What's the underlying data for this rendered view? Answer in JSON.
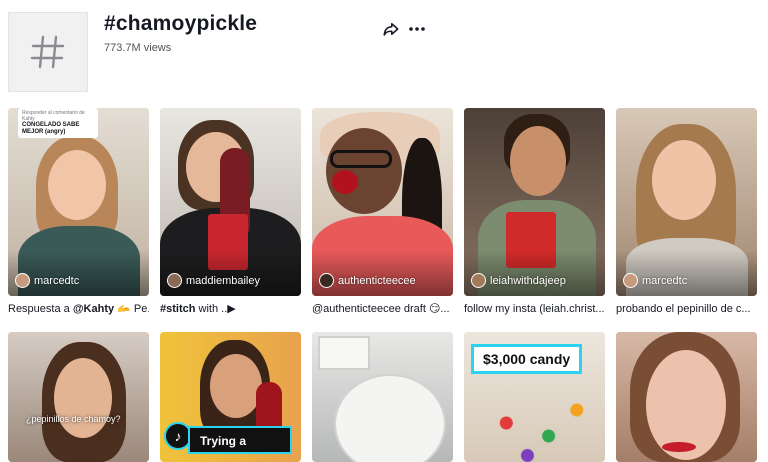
{
  "header": {
    "title": "#chamoypickle",
    "views": "773.7M views",
    "hashtag_icon": "hashtag-icon",
    "share_icon": "share-icon",
    "more_icon": "more-icon"
  },
  "videos_row1": [
    {
      "username": "marcedtc",
      "caption_prefix": "Respuesta a ",
      "caption_bold": "@Kahty",
      "caption_suffix": " 🫴 Pe..."
    },
    {
      "username": "maddiembailey",
      "caption_prefix": "",
      "caption_bold": "#stitch",
      "caption_suffix": " with ..▶"
    },
    {
      "username": "authenticteecee",
      "caption_prefix": "@authenticteecee draft 😏...",
      "caption_bold": "",
      "caption_suffix": ""
    },
    {
      "username": "leiahwithdajeep",
      "caption_prefix": "follow my insta (leiah.christ...",
      "caption_bold": "",
      "caption_suffix": ""
    },
    {
      "username": "marcedtc",
      "caption_prefix": "probando el pepinillo de c...",
      "caption_bold": "",
      "caption_suffix": ""
    }
  ],
  "overlays": {
    "reply_small": "Responder al comentario de Kahty",
    "reply_main": "CONGELADO SABE MEJOR (angry)",
    "subtitle": "¿pepinillos de chamoy?",
    "candy": "$3,000 candy",
    "trying": "Trying a"
  },
  "colors": {
    "accent_cyan": "#2bd3ee",
    "text_primary": "#161823"
  }
}
